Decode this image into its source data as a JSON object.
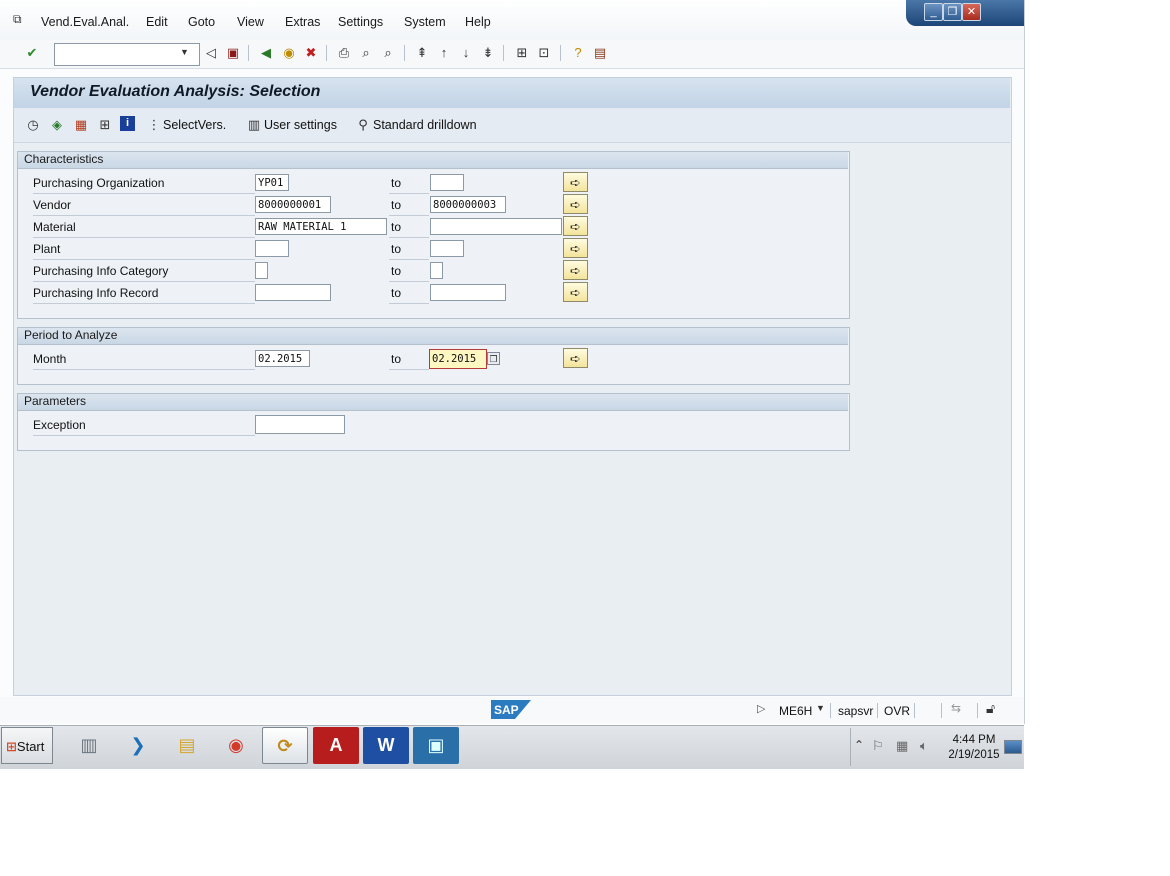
{
  "menu": [
    "Vend.Eval.Anal.",
    "Edit",
    "Goto",
    "View",
    "Extras",
    "Settings",
    "System",
    "Help"
  ],
  "window_controls": {
    "minimize": "_",
    "restore": "❐",
    "close": "✕"
  },
  "command_field": {
    "value": "",
    "placeholder": ""
  },
  "title": "Vendor Evaluation Analysis: Selection",
  "app_toolbar": {
    "select_versions": "SelectVers.",
    "user_settings": "User settings",
    "standard_drilldown": "Standard drilldown"
  },
  "characteristics": {
    "title": "Characteristics",
    "to_label": "to",
    "rows": [
      {
        "label": "Purchasing Organization",
        "from": "YP01",
        "to": ""
      },
      {
        "label": "Vendor",
        "from": "8000000001",
        "to": "8000000003"
      },
      {
        "label": "Material",
        "from": "RAW MATERIAL 1",
        "to": ""
      },
      {
        "label": "Plant",
        "from": "",
        "to": ""
      },
      {
        "label": "Purchasing Info Category",
        "from": "",
        "to": ""
      },
      {
        "label": "Purchasing Info Record",
        "from": "",
        "to": ""
      }
    ]
  },
  "period": {
    "title": "Period to Analyze",
    "to_label": "to",
    "month_label": "Month",
    "from": "02.2015",
    "to": "02.2015"
  },
  "parameters": {
    "title": "Parameters",
    "exception_label": "Exception",
    "exception_value": ""
  },
  "status_bar": {
    "logo": "SAP",
    "transaction": "ME6H",
    "server": "sapsvr",
    "mode": "OVR"
  },
  "taskbar": {
    "start": "Start",
    "clock_time": "4:44 PM",
    "clock_date": "2/19/2015"
  },
  "colors": {
    "title_bar": "#c9d8e8",
    "content_bg": "#e9eef3",
    "focus_field": "#fff7c2",
    "sap_logo": "#2a7bc0"
  }
}
